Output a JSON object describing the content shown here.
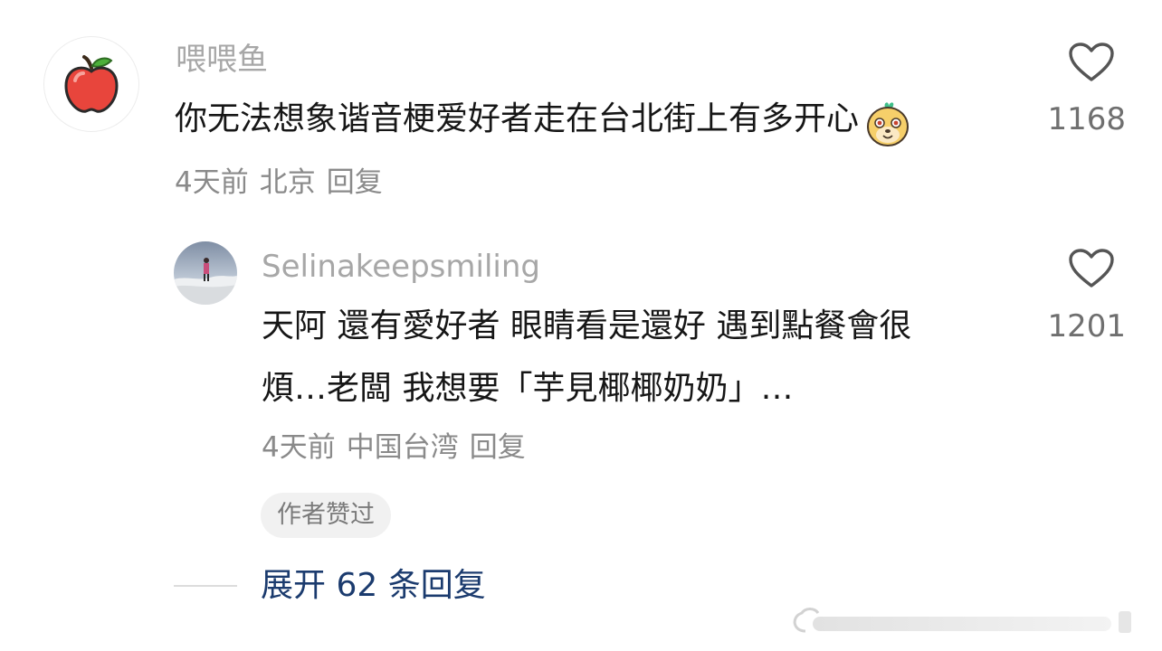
{
  "comment": {
    "username": "喂喂鱼",
    "avatar_icon": "apple-icon",
    "text": "你无法想象谐音梗爱好者走在台北街上有多开心",
    "emoji_icon": "happy-dog-emoji-icon",
    "time": "4天前",
    "location": "北京",
    "reply_label": "回复",
    "like_count": "1168"
  },
  "reply": {
    "username": "Selinakeepsmiling",
    "text_line1": "天阿 還有愛好者 眼睛看是還好 遇到點餐會很",
    "text_line2": "煩…老闆 我想要「芋見椰椰奶奶」…",
    "time": "4天前",
    "location": "中国台湾",
    "reply_label": "回复",
    "like_count": "1201",
    "author_badge": "作者赞过"
  },
  "expand_label": "展开 62 条回复",
  "colors": {
    "accent_link": "#1b3b6e",
    "muted_text": "#a7a7a7",
    "primary_text": "#161616"
  }
}
